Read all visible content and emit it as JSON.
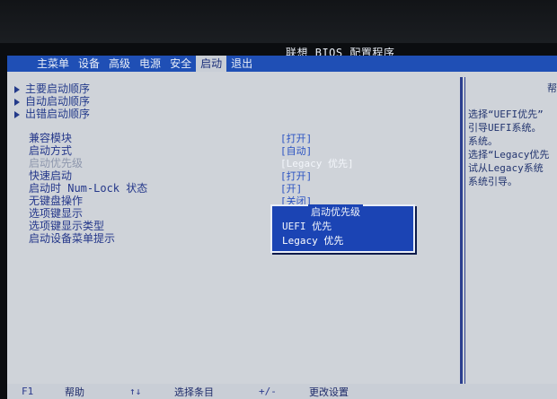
{
  "app": {
    "title": "联想 BIOS 配置程序"
  },
  "menu": {
    "items": [
      {
        "label": "主菜单"
      },
      {
        "label": "设备"
      },
      {
        "label": "高级"
      },
      {
        "label": "电源"
      },
      {
        "label": "安全"
      },
      {
        "label": "启动",
        "active": true
      },
      {
        "label": "退出"
      }
    ]
  },
  "submenus": [
    {
      "label": "主要启动顺序"
    },
    {
      "label": "自动启动顺序"
    },
    {
      "label": "出错启动顺序"
    }
  ],
  "options": [
    {
      "label": "兼容模块",
      "value": "[打开]"
    },
    {
      "label": "启动方式",
      "value": "[自动]"
    },
    {
      "label": "启动优先级",
      "value": "[Legacy 优先]",
      "disabled": true
    },
    {
      "label": "快速启动",
      "value": "[打开]"
    },
    {
      "label": "启动时 Num-Lock 状态",
      "value": "[开]"
    },
    {
      "label": "无键盘操作",
      "value": "[关闭]"
    },
    {
      "label": "选项键显示",
      "value": ""
    },
    {
      "label": "选项键显示类型",
      "value": ""
    },
    {
      "label": "启动设备菜单提示",
      "value": ""
    }
  ],
  "popup": {
    "title": "启动优先级",
    "options": [
      {
        "label": "UEFI 优先"
      },
      {
        "label": "Legacy 优先",
        "selected": true
      }
    ]
  },
  "help": {
    "title": "帮",
    "lines": [
      "选择“UEFI优先”",
      "引导UEFI系统。",
      "系统。",
      "选择“Legacy优先",
      "试从Legacy系统",
      "系统引导。"
    ]
  },
  "footer": {
    "items": [
      {
        "key": "F1",
        "desc": "帮助"
      },
      {
        "key": "↑↓",
        "desc": "选择条目"
      },
      {
        "key": "+/-",
        "desc": "更改设置"
      }
    ]
  },
  "colors": {
    "menubar": "#1f4fb5",
    "panel": "#cfd3d9",
    "popup": "#1b44b4",
    "label_text": "#24378a",
    "value_text": "#2a52c2"
  }
}
